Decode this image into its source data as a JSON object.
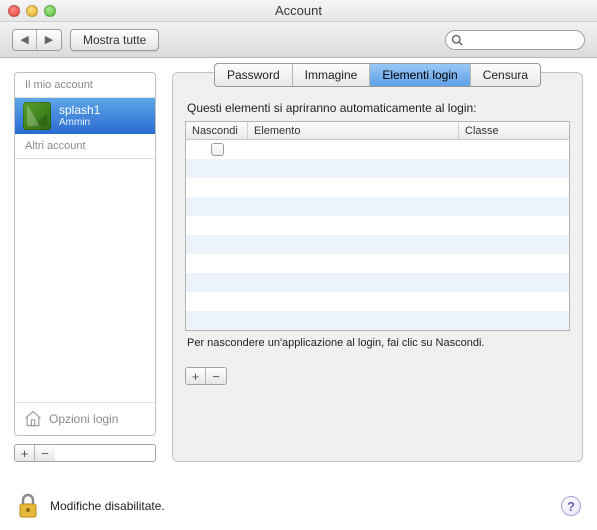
{
  "window": {
    "title": "Account"
  },
  "toolbar": {
    "show_all": "Mostra tutte",
    "search_placeholder": ""
  },
  "sidebar": {
    "header_my_account": "Il mio account",
    "header_other": "Altri account",
    "user": {
      "name": "splash1",
      "role": "Ammin"
    },
    "login_options": "Opzioni login"
  },
  "tabs": {
    "password": "Password",
    "image": "Immagine",
    "login_items": "Elementi login",
    "parental": "Censura"
  },
  "login_items": {
    "description": "Questi elementi si apriranno automaticamente al login:",
    "col_hide": "Nascondi",
    "col_element": "Elemento",
    "col_class": "Classe",
    "hint": "Per nascondere un'applicazione al login, fai clic su Nascondi.",
    "rows": [
      {
        "hide": false,
        "element": "",
        "class": ""
      }
    ]
  },
  "footer": {
    "lock_text": "Modifiche disabilitate."
  },
  "glyphs": {
    "back": "◀",
    "fwd": "▶",
    "plus": "+",
    "minus": "−",
    "help": "?"
  }
}
